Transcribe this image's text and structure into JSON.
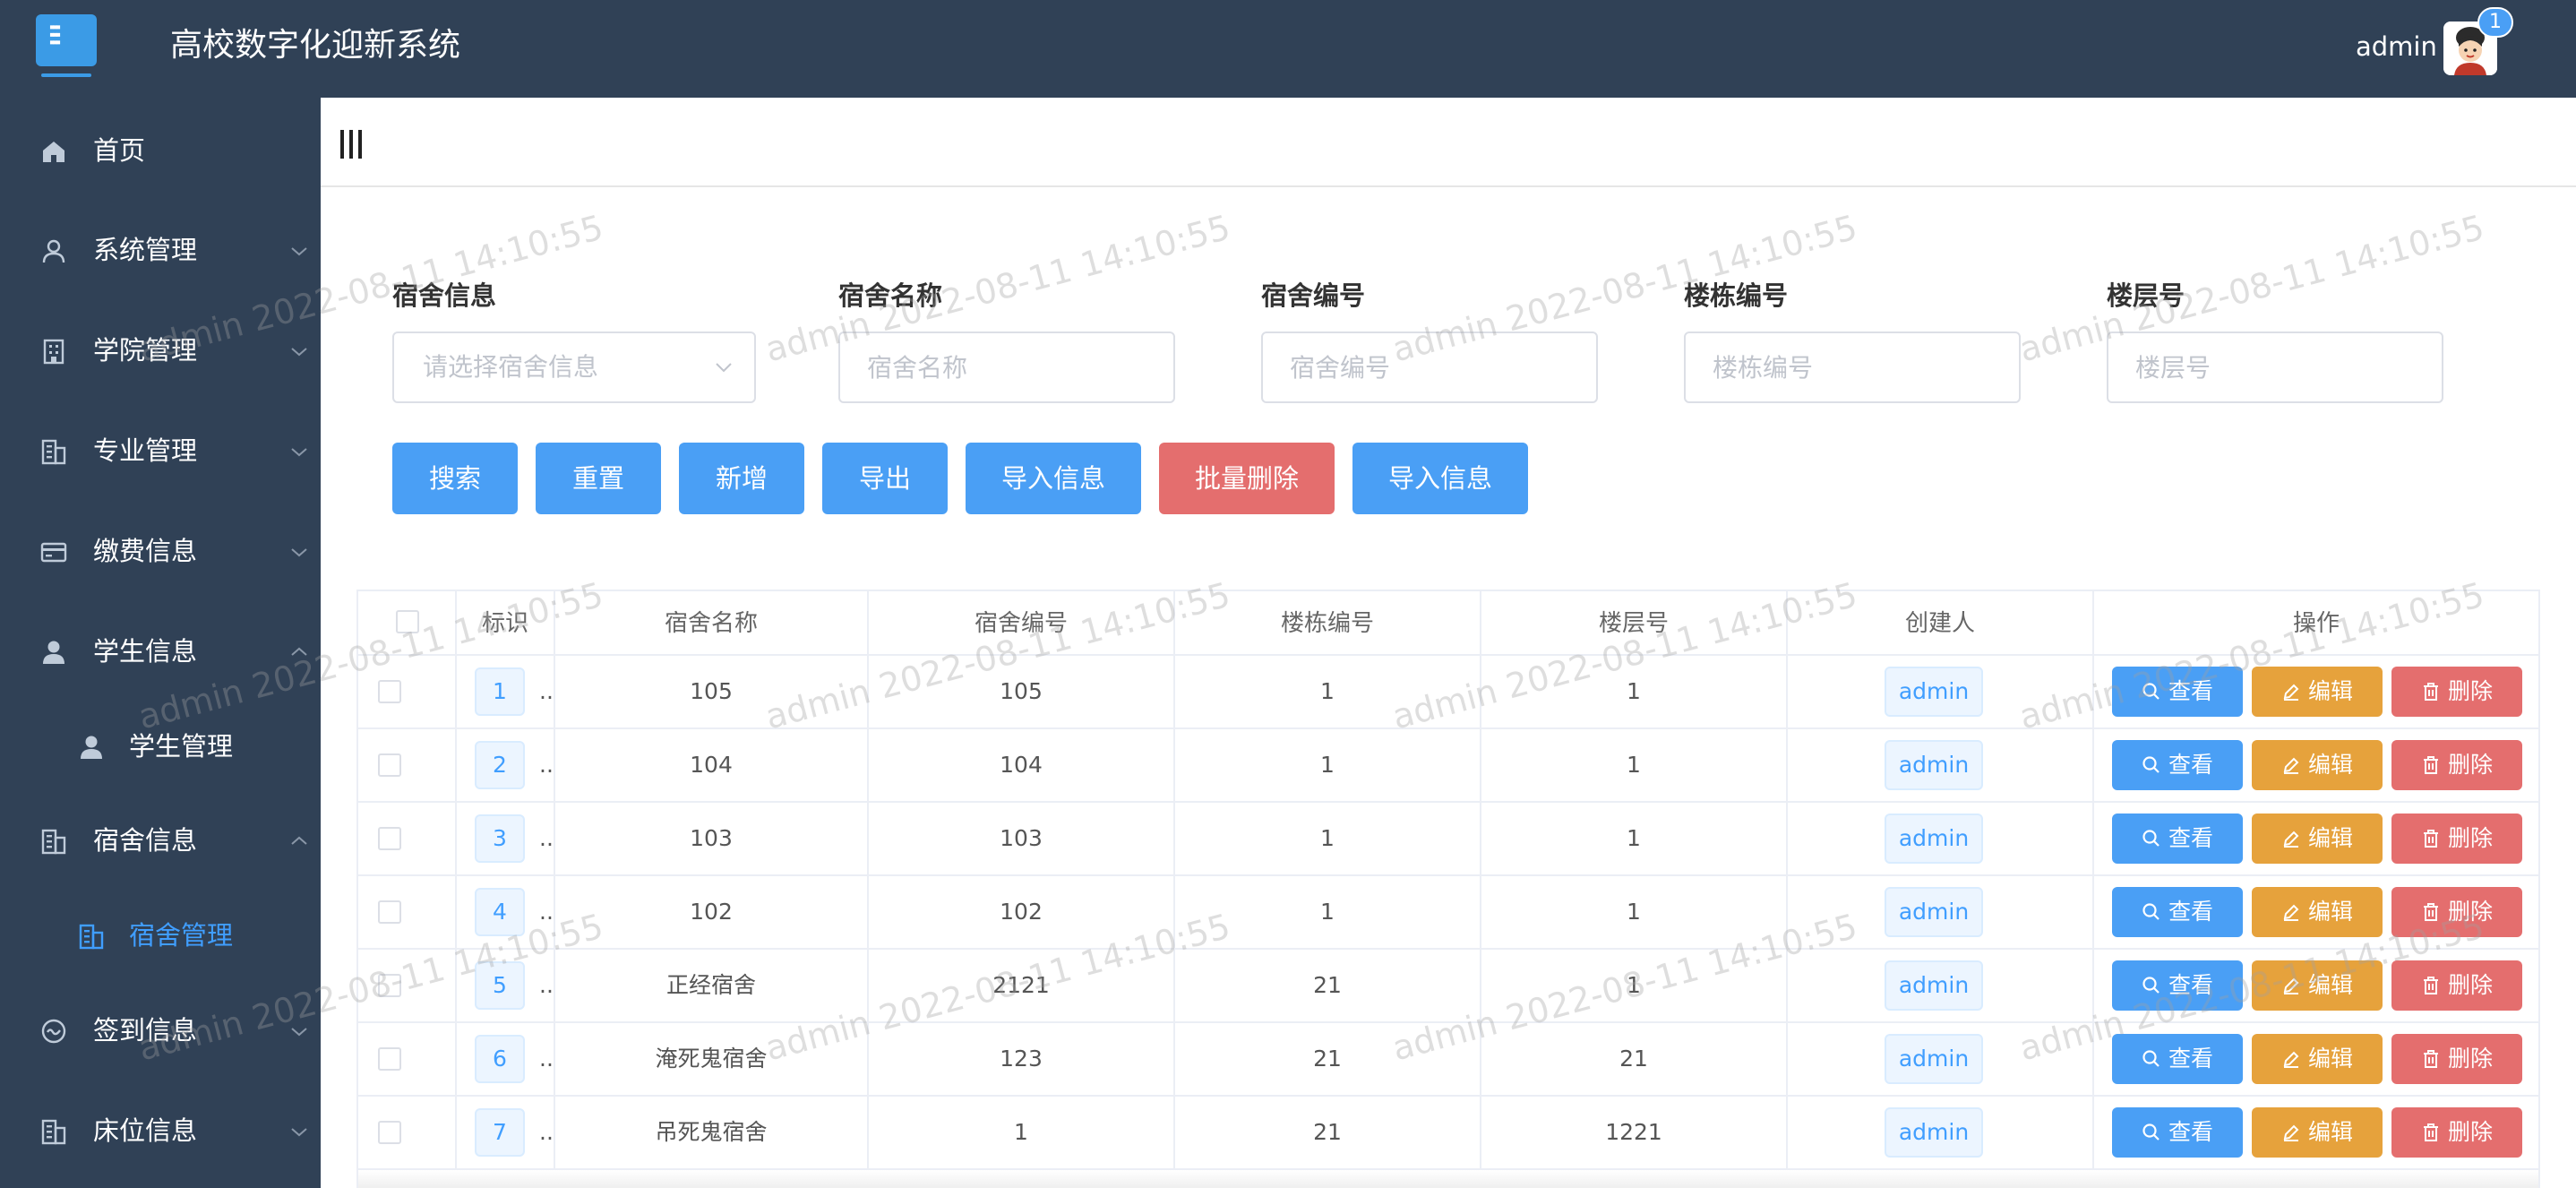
{
  "header": {
    "app_title": "高校数字化迎新系统",
    "user_name": "admin",
    "notification_count": "1"
  },
  "sidebar": {
    "items": [
      {
        "label": "首页",
        "icon": "home-icon"
      },
      {
        "label": "系统管理",
        "icon": "user-icon"
      },
      {
        "label": "学院管理",
        "icon": "building-icon"
      },
      {
        "label": "专业管理",
        "icon": "office-icon"
      },
      {
        "label": "缴费信息",
        "icon": "card-icon"
      },
      {
        "label": "学生信息",
        "icon": "person-icon"
      },
      {
        "label": "学生管理",
        "icon": "person-icon"
      },
      {
        "label": "宿舍信息",
        "icon": "office-icon"
      },
      {
        "label": "宿舍管理",
        "icon": "office-icon"
      },
      {
        "label": "签到信息",
        "icon": "smile-icon"
      },
      {
        "label": "床位信息",
        "icon": "office-icon"
      }
    ]
  },
  "filters": {
    "dorm_info": {
      "label": "宿舍信息",
      "placeholder": "请选择宿舍信息"
    },
    "dorm_name": {
      "label": "宿舍名称",
      "placeholder": "宿舍名称"
    },
    "dorm_no": {
      "label": "宿舍编号",
      "placeholder": "宿舍编号"
    },
    "building_no": {
      "label": "楼栋编号",
      "placeholder": "楼栋编号"
    },
    "floor_no": {
      "label": "楼层号",
      "placeholder": "楼层号"
    }
  },
  "actions": {
    "search": "搜索",
    "reset": "重置",
    "add": "新增",
    "export": "导出",
    "import1": "导入信息",
    "batch_delete": "批量删除",
    "import2": "导入信息"
  },
  "table": {
    "columns": [
      "标识",
      "宿舍名称",
      "宿舍编号",
      "楼栋编号",
      "楼层号",
      "创建人",
      "操作"
    ],
    "rows": [
      {
        "id": "1",
        "name": "105",
        "no": "105",
        "building": "1",
        "floor": "1",
        "creator": "admin"
      },
      {
        "id": "2",
        "name": "104",
        "no": "104",
        "building": "1",
        "floor": "1",
        "creator": "admin"
      },
      {
        "id": "3",
        "name": "103",
        "no": "103",
        "building": "1",
        "floor": "1",
        "creator": "admin"
      },
      {
        "id": "4",
        "name": "102",
        "no": "102",
        "building": "1",
        "floor": "1",
        "creator": "admin"
      },
      {
        "id": "5",
        "name": "正经宿舍",
        "no": "2121",
        "building": "21",
        "floor": "1",
        "creator": "admin"
      },
      {
        "id": "6",
        "name": "淹死鬼宿舍",
        "no": "123",
        "building": "21",
        "floor": "21",
        "creator": "admin"
      },
      {
        "id": "7",
        "name": "吊死鬼宿舍",
        "no": "1",
        "building": "21",
        "floor": "1221",
        "creator": "admin"
      }
    ],
    "id_ellipsis": "..",
    "op_view": "查看",
    "op_edit": "编辑",
    "op_delete": "删除"
  },
  "watermark": "admin 2022-08-11 14:10:55"
}
